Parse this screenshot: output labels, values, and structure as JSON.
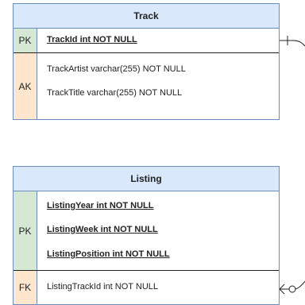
{
  "entities": {
    "track": {
      "title": "Track",
      "pk_label": "PK",
      "pk_attrs": [
        "TrackId int NOT NULL"
      ],
      "ak_label": "AK",
      "ak_attrs": [
        "TrackArtist varchar(255) NOT NULL",
        "TrackTitle varchar(255) NOT NULL"
      ]
    },
    "listing": {
      "title": "Listing",
      "pk_label": "PK",
      "pk_attrs": [
        "ListingYear int NOT NULL",
        "ListingWeek int NOT NULL",
        "ListingPosition int NOT NULL"
      ],
      "fk_label": "FK",
      "fk_attrs": [
        "ListingTrackId int NOT NULL"
      ]
    }
  },
  "colors": {
    "header_fill": "#dae8fc",
    "header_stroke": "#6c8ebf",
    "pk_fill": "#d5e8d4",
    "ak_fill": "#ffe6cc",
    "fk_fill": "#ffe6cc"
  }
}
